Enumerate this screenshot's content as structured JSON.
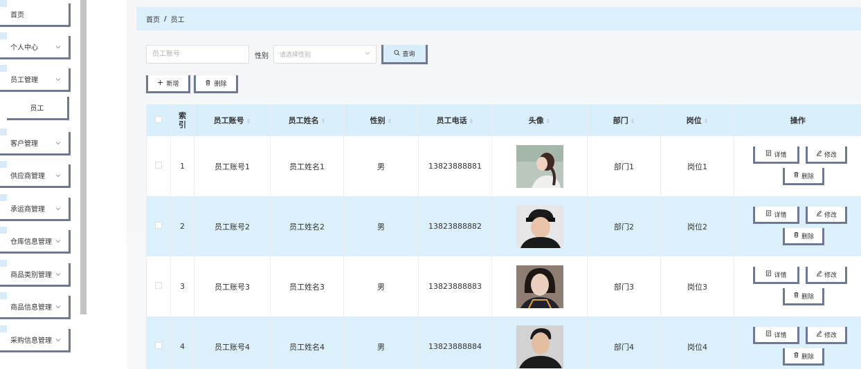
{
  "sidebar": {
    "items": [
      {
        "label": "首页",
        "has_chevron": false
      },
      {
        "label": "个人中心",
        "has_chevron": true
      },
      {
        "label": "员工管理",
        "has_chevron": true
      },
      {
        "label": "员工",
        "has_chevron": false,
        "sub": true
      },
      {
        "label": "客户管理",
        "has_chevron": true
      },
      {
        "label": "供应商管理",
        "has_chevron": true
      },
      {
        "label": "承运商管理",
        "has_chevron": true
      },
      {
        "label": "仓库信息管理",
        "has_chevron": true
      },
      {
        "label": "商品类别管理",
        "has_chevron": true
      },
      {
        "label": "商品信息管理",
        "has_chevron": true
      },
      {
        "label": "采购信息管理",
        "has_chevron": true
      }
    ]
  },
  "breadcrumb": {
    "home": "首页",
    "separator": "/",
    "current": "员工"
  },
  "search": {
    "account_placeholder": "员工账号",
    "gender_label": "性别",
    "gender_placeholder": "请选择性别",
    "query_label": "查询"
  },
  "actions": {
    "add_label": "新增",
    "delete_label": "删除"
  },
  "table": {
    "headers": {
      "index": "索引",
      "account": "员工账号",
      "name": "员工姓名",
      "gender": "性别",
      "phone": "员工电话",
      "avatar": "头像",
      "dept": "部门",
      "post": "岗位",
      "ops": "操作"
    },
    "rows": [
      {
        "index": "1",
        "account": "员工账号1",
        "name": "员工姓名1",
        "gender": "男",
        "phone": "13823888881",
        "dept": "部门1",
        "post": "岗位1"
      },
      {
        "index": "2",
        "account": "员工账号2",
        "name": "员工姓名2",
        "gender": "男",
        "phone": "13823888882",
        "dept": "部门2",
        "post": "岗位2"
      },
      {
        "index": "3",
        "account": "员工账号3",
        "name": "员工姓名3",
        "gender": "男",
        "phone": "13823888883",
        "dept": "部门3",
        "post": "岗位3"
      },
      {
        "index": "4",
        "account": "员工账号4",
        "name": "员工姓名4",
        "gender": "男",
        "phone": "13823888884",
        "dept": "部门4",
        "post": "岗位4"
      }
    ],
    "op_labels": {
      "detail": "详情",
      "edit": "修改",
      "delete": "删除"
    }
  },
  "colors": {
    "accent": "#6f7893",
    "header_bg": "#d9f0fc",
    "row_alt": "#dcf0fc"
  }
}
